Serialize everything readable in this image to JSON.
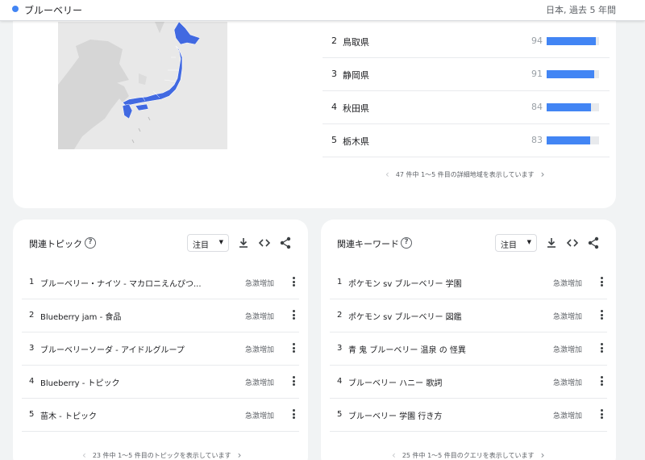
{
  "header": {
    "term": "ブルーベリー",
    "scope": "日本, 過去 5 年間",
    "dot_color": "#4285f4"
  },
  "regions": {
    "rows": [
      {
        "rank": "2",
        "name": "鳥取県",
        "score": "94",
        "value": 94
      },
      {
        "rank": "3",
        "name": "静岡県",
        "score": "91",
        "value": 91
      },
      {
        "rank": "4",
        "name": "秋田県",
        "score": "84",
        "value": 84
      },
      {
        "rank": "5",
        "name": "栃木県",
        "score": "83",
        "value": 83
      }
    ],
    "pager_text": "47 件中 1～5 件目の詳細地域を表示しています"
  },
  "topics": {
    "title": "関連トピック",
    "help_icon": "?",
    "select_value": "注目",
    "rows": [
      {
        "rank": "1",
        "label": "ブルーベリー・ナイツ - マカロニえんぴつ...",
        "status": "急激増加"
      },
      {
        "rank": "2",
        "label": "Blueberry jam - 食品",
        "status": "急激増加"
      },
      {
        "rank": "3",
        "label": "ブルーベリーソーダ - アイドルグループ",
        "status": "急激増加"
      },
      {
        "rank": "4",
        "label": "Blueberry - トピック",
        "status": "急激増加"
      },
      {
        "rank": "5",
        "label": "苗木 - トピック",
        "status": "急激増加"
      }
    ],
    "pager_text": "23 件中 1～5 件目のトピックを表示しています"
  },
  "queries": {
    "title": "関連キーワード",
    "help_icon": "?",
    "select_value": "注目",
    "rows": [
      {
        "rank": "1",
        "label": "ポケモン sv ブルーベリー 学園",
        "status": "急激増加"
      },
      {
        "rank": "2",
        "label": "ポケモン sv ブルーベリー 図鑑",
        "status": "急激増加"
      },
      {
        "rank": "3",
        "label": "青 鬼 ブルーベリー 温泉 の 怪異",
        "status": "急激増加"
      },
      {
        "rank": "4",
        "label": "ブルーベリー ハニー 歌詞",
        "status": "急激増加"
      },
      {
        "rank": "5",
        "label": "ブルーベリー 学園 行き方",
        "status": "急激増加"
      }
    ],
    "pager_text": "25 件中 1～5 件目のクエリを表示しています"
  },
  "icons": {
    "prev": "chevron-left-icon",
    "next": "chevron-right-icon",
    "download": "download-icon",
    "embed": "embed-code-icon",
    "share": "share-icon",
    "menu": "more-vert-icon",
    "caret": "dropdown-caret-icon"
  },
  "colors": {
    "accent": "#4285f4",
    "map_highlight": "#4169e1",
    "map_land": "#d6d6d6",
    "map_water": "#e8e8e8"
  }
}
